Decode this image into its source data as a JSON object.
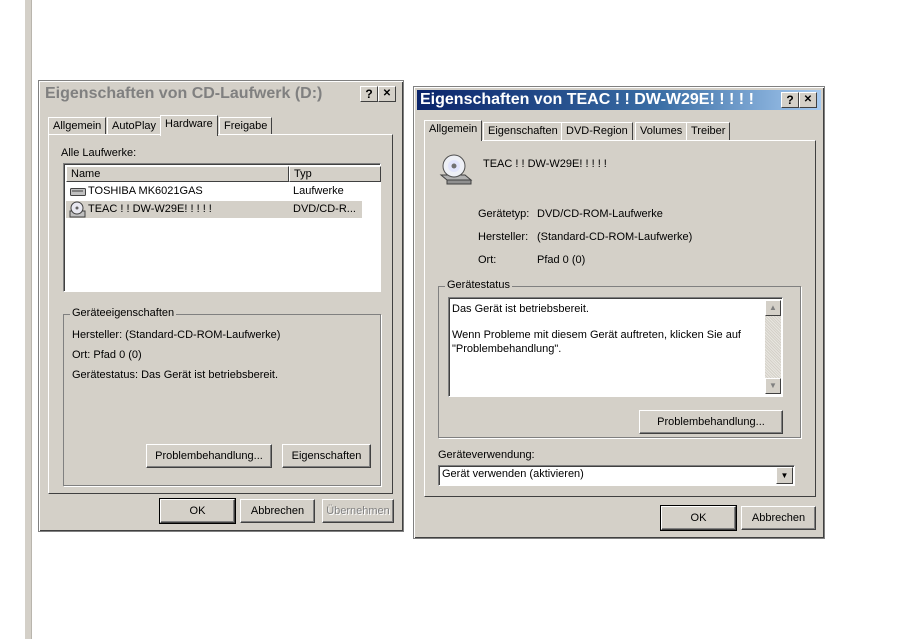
{
  "dialog1": {
    "title": "Eigenschaften von CD-Laufwerk (D:)",
    "help_btn": "?",
    "close_btn": "✕",
    "tabs": [
      "Allgemein",
      "AutoPlay",
      "Hardware",
      "Freigabe"
    ],
    "active_tab": "Hardware",
    "all_drives_label": "Alle Laufwerke:",
    "columns": [
      "Name",
      "Typ"
    ],
    "rows": [
      {
        "name": "TOSHIBA MK6021GAS",
        "type": "Laufwerke",
        "icon": "hard-drive-icon"
      },
      {
        "name": "TEAC ! ! DW-W29E! ! ! ! !",
        "type": "DVD/CD-R...",
        "icon": "cd-drive-icon",
        "selected": true
      }
    ],
    "device_props_label": "Geräteeigenschaften",
    "manufacturer": "Hersteller: (Standard-CD-ROM-Laufwerke)",
    "location": "Ort: Pfad 0 (0)",
    "status": "Gerätestatus: Das Gerät ist betriebsbereit.",
    "troubleshoot_btn": "Problembehandlung...",
    "properties_btn": "Eigenschaften",
    "ok_btn": "OK",
    "cancel_btn": "Abbrechen",
    "apply_btn": "Übernehmen"
  },
  "dialog2": {
    "title": "Eigenschaften von TEAC ! ! DW-W29E! ! ! ! !",
    "help_btn": "?",
    "close_btn": "✕",
    "tabs": [
      "Allgemein",
      "Eigenschaften",
      "DVD-Region",
      "Volumes",
      "Treiber"
    ],
    "active_tab": "Allgemein",
    "device_name": "TEAC ! ! DW-W29E! ! ! ! !",
    "device_type_label": "Gerätetyp:",
    "device_type_value": "DVD/CD-ROM-Laufwerke",
    "manufacturer_label": "Hersteller:",
    "manufacturer_value": "(Standard-CD-ROM-Laufwerke)",
    "location_label": "Ort:",
    "location_value": "Pfad 0 (0)",
    "status_group_label": "Gerätestatus",
    "status_line1": "Das Gerät ist betriebsbereit.",
    "status_line2": "Wenn Probleme mit diesem Gerät auftreten, klicken Sie auf",
    "status_line3": "\"Problembehandlung\".",
    "troubleshoot_btn": "Problembehandlung...",
    "usage_label": "Geräteverwendung:",
    "usage_value": "Gerät verwenden (aktivieren)",
    "ok_btn": "OK",
    "cancel_btn": "Abbrechen"
  }
}
